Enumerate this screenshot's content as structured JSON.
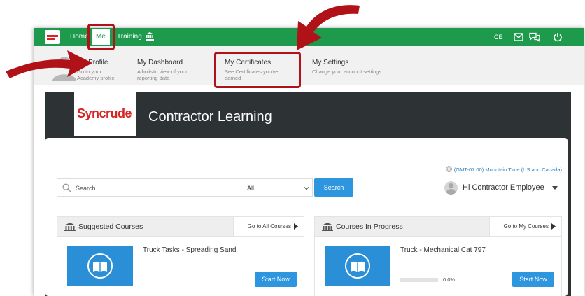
{
  "topbar": {
    "nav": [
      {
        "label": "Home"
      },
      {
        "label": "Me"
      },
      {
        "label": "Training"
      }
    ],
    "right": {
      "ce_label": "CE"
    }
  },
  "submenu": {
    "items": [
      {
        "title": "My Profile",
        "desc_line1": "Go to your",
        "desc_line2": "Academy profile"
      },
      {
        "title": "My Dashboard",
        "desc_line1": "A holistic view of your",
        "desc_line2": "reporting data"
      },
      {
        "title": "My Certificates",
        "desc_line1": "See Certificates you've",
        "desc_line2": "earned"
      },
      {
        "title": "My Settings",
        "desc_line1": "Change your account settings",
        "desc_line2": ""
      }
    ]
  },
  "hero": {
    "logo_text": "Syncrude",
    "title": "Contractor Learning"
  },
  "card": {
    "timezone": "(GMT-07:00) Mountain Time (US and Canada)",
    "search": {
      "placeholder": "Search...",
      "filter_value": "All",
      "button_label": "Search"
    },
    "user": {
      "greeting": "Hi Contractor Employee"
    },
    "panels": [
      {
        "title": "Suggested Courses",
        "link_label": "Go to All Courses",
        "course": {
          "name": "Truck Tasks - Spreading Sand",
          "button_label": "Start Now"
        }
      },
      {
        "title": "Courses In Progress",
        "link_label": "Go to My Courses",
        "course": {
          "name": "Truck - Mechanical Cat 797",
          "button_label": "Start Now",
          "progress_label": "0.0%",
          "progress_fraction": 0.0
        }
      }
    ]
  },
  "colors": {
    "topbar_green": "#1e9a4c",
    "accent_blue": "#2d96de",
    "hero_dark": "#2d3234",
    "highlight_red": "#b01217",
    "brand_red": "#d92424"
  },
  "icons": [
    "bank-icon",
    "mail-icon",
    "chat-icon",
    "power-icon",
    "globe-icon",
    "search-icon",
    "chevron-down-icon",
    "caret-down-icon",
    "courses-icon",
    "arrow-right-icon",
    "open-book-icon"
  ]
}
